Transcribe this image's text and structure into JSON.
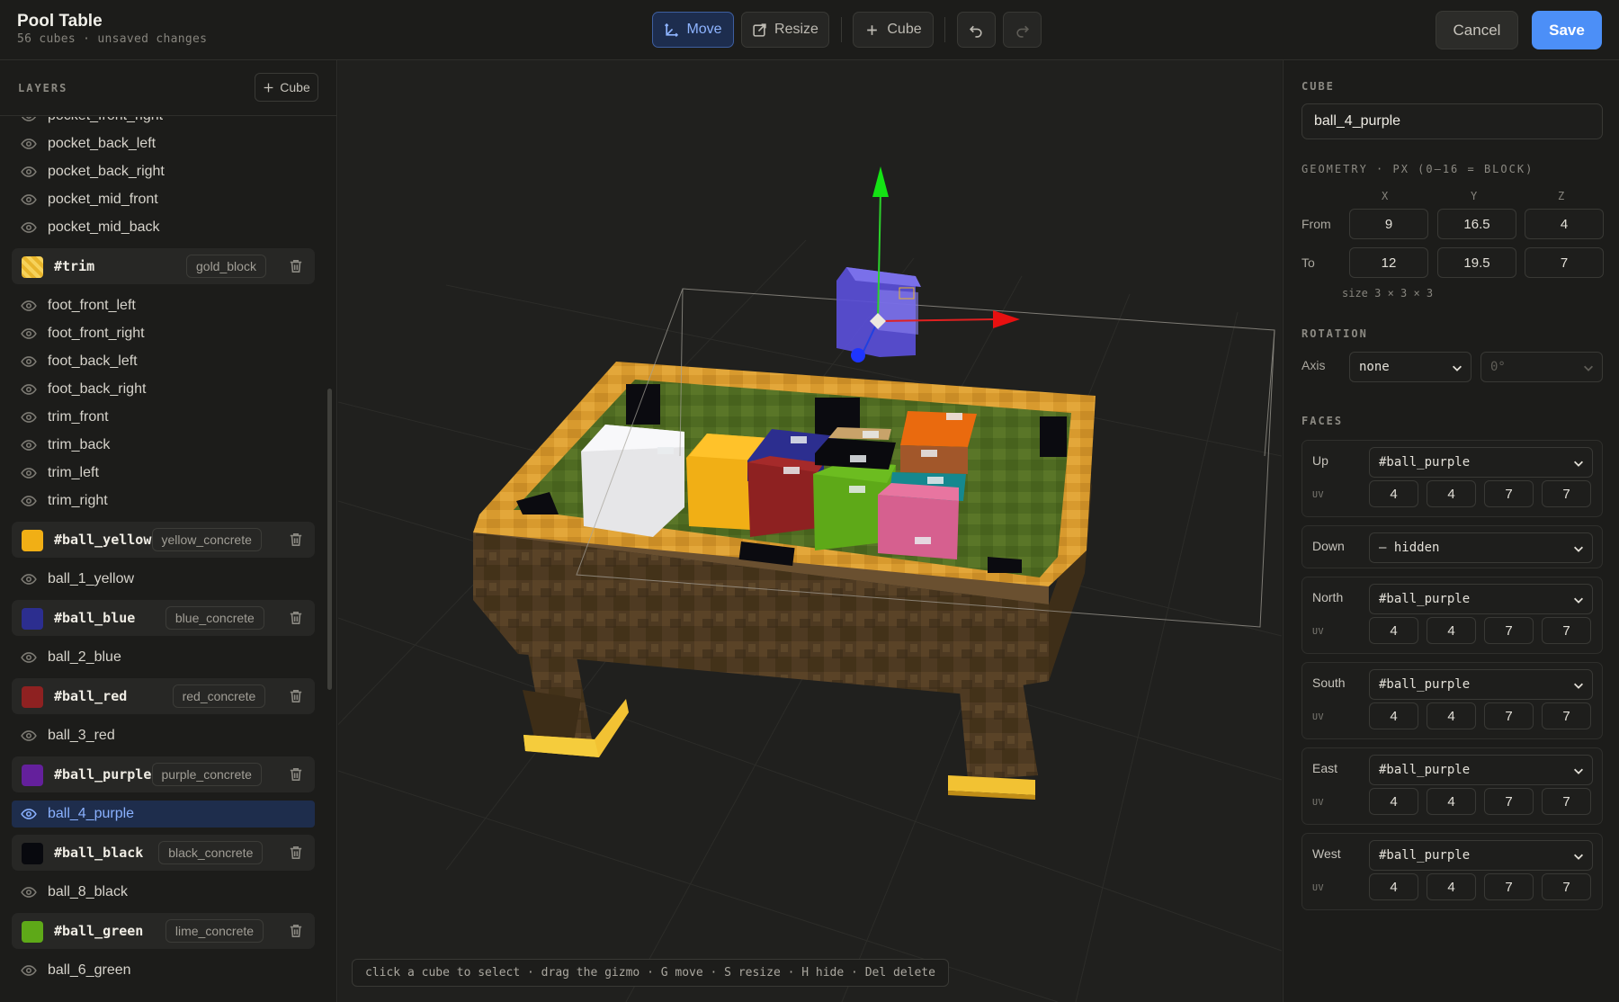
{
  "header": {
    "title": "Pool Table",
    "subtitle": "56 cubes · unsaved changes",
    "tools": {
      "move": "Move",
      "resize": "Resize",
      "cube": "Cube"
    },
    "cancel": "Cancel",
    "save": "Save"
  },
  "layers": {
    "title": "LAYERS",
    "add_label": "Cube",
    "rows": [
      {
        "kind": "item",
        "label": "pocket_front_right"
      },
      {
        "kind": "item",
        "label": "pocket_back_left"
      },
      {
        "kind": "item",
        "label": "pocket_back_right"
      },
      {
        "kind": "item",
        "label": "pocket_mid_front"
      },
      {
        "kind": "item",
        "label": "pocket_mid_back"
      },
      {
        "kind": "group",
        "label": "#trim",
        "texture": "gold_block",
        "color": "#e8b52c"
      },
      {
        "kind": "item",
        "label": "foot_front_left"
      },
      {
        "kind": "item",
        "label": "foot_front_right"
      },
      {
        "kind": "item",
        "label": "foot_back_left"
      },
      {
        "kind": "item",
        "label": "foot_back_right"
      },
      {
        "kind": "item",
        "label": "trim_front"
      },
      {
        "kind": "item",
        "label": "trim_back"
      },
      {
        "kind": "item",
        "label": "trim_left"
      },
      {
        "kind": "item",
        "label": "trim_right"
      },
      {
        "kind": "group",
        "label": "#ball_yellow",
        "texture": "yellow_concrete",
        "color": "#f1af15"
      },
      {
        "kind": "item",
        "label": "ball_1_yellow"
      },
      {
        "kind": "group",
        "label": "#ball_blue",
        "texture": "blue_concrete",
        "color": "#2c2e8f"
      },
      {
        "kind": "item",
        "label": "ball_2_blue"
      },
      {
        "kind": "group",
        "label": "#ball_red",
        "texture": "red_concrete",
        "color": "#8e2121"
      },
      {
        "kind": "item",
        "label": "ball_3_red"
      },
      {
        "kind": "group",
        "label": "#ball_purple",
        "texture": "purple_concrete",
        "color": "#64209c"
      },
      {
        "kind": "item",
        "label": "ball_4_purple",
        "selected": true
      },
      {
        "kind": "group",
        "label": "#ball_black",
        "texture": "black_concrete",
        "color": "#08090e"
      },
      {
        "kind": "item",
        "label": "ball_8_black"
      },
      {
        "kind": "group",
        "label": "#ball_green",
        "texture": "lime_concrete",
        "color": "#5ea918"
      },
      {
        "kind": "item",
        "label": "ball_6_green"
      }
    ]
  },
  "viewport": {
    "hint": "click a cube to select · drag the gizmo · G move · S resize · H hide · Del delete"
  },
  "cube": {
    "section": "CUBE",
    "name": "ball_4_purple",
    "geometry_title": "GEOMETRY · PX (0–16 = BLOCK)",
    "axes": [
      "X",
      "Y",
      "Z"
    ],
    "from_label": "From",
    "to_label": "To",
    "from": [
      "9",
      "16.5",
      "4"
    ],
    "to": [
      "12",
      "19.5",
      "7"
    ],
    "size_note": "size 3 × 3 × 3",
    "rotation_title": "ROTATION",
    "axis_label": "Axis",
    "axis_value": "none",
    "angle_value": "0°",
    "faces_title": "FACES",
    "uv_label": "UV",
    "faces": [
      {
        "name": "Up",
        "texture": "#ball_purple",
        "uv": [
          "4",
          "4",
          "7",
          "7"
        ]
      },
      {
        "name": "Down",
        "texture": "— hidden",
        "uv": null
      },
      {
        "name": "North",
        "texture": "#ball_purple",
        "uv": [
          "4",
          "4",
          "7",
          "7"
        ]
      },
      {
        "name": "South",
        "texture": "#ball_purple",
        "uv": [
          "4",
          "4",
          "7",
          "7"
        ]
      },
      {
        "name": "East",
        "texture": "#ball_purple",
        "uv": [
          "4",
          "4",
          "7",
          "7"
        ]
      },
      {
        "name": "West",
        "texture": "#ball_purple",
        "uv": [
          "4",
          "4",
          "7",
          "7"
        ]
      }
    ]
  }
}
